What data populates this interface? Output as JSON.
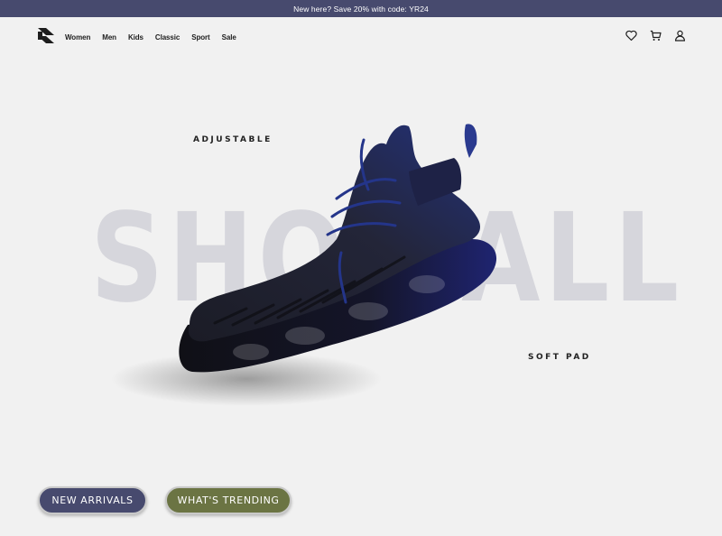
{
  "promo": {
    "text": "New here? Save 20% with code: YR24"
  },
  "brand": {
    "logo_icon": "brand-logo-icon"
  },
  "nav": {
    "items": [
      {
        "label": "Women"
      },
      {
        "label": "Men"
      },
      {
        "label": "Kids"
      },
      {
        "label": "Classic"
      },
      {
        "label": "Sport"
      },
      {
        "label": "Sale"
      }
    ]
  },
  "header_icons": [
    "heart-icon",
    "cart-icon",
    "user-icon"
  ],
  "hero": {
    "background_word": "SHOWALL",
    "label_top": "ADJUSTABLE",
    "label_bottom": "SOFT PAD"
  },
  "buttons": {
    "new_arrivals": "NEW ARRIVALS",
    "trending": "WHAT'S TRENDING"
  },
  "colors": {
    "promo_bg": "#474a6e",
    "primary_button": "#474a6e",
    "secondary_button": "#6b7443",
    "background": "#f1f1f1"
  }
}
